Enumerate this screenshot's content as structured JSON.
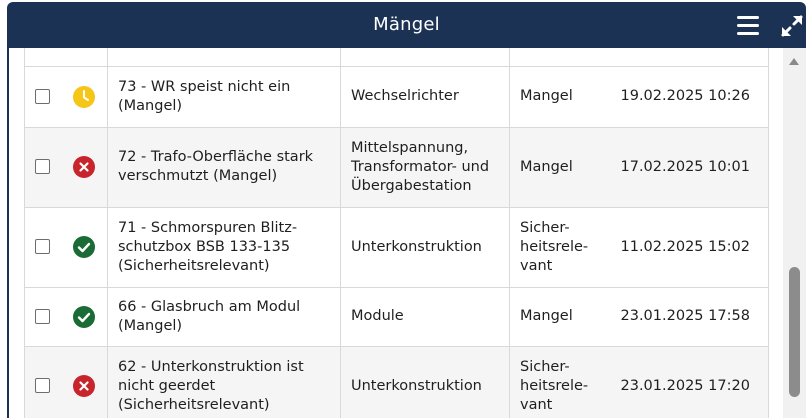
{
  "header": {
    "title": "Mängel",
    "menu_icon": "hamburger-menu-icon",
    "expand_icon": "expand-fullscreen-icon"
  },
  "rows": [
    {
      "status": "pending",
      "title": "73 - WR speist nicht ein (Mangel)",
      "category": "Wechselrichter",
      "type": "Mangel",
      "date": "19.02.2025 10:26"
    },
    {
      "status": "error",
      "title": "72 - Trafo-Oberfläche stark verschmutzt (Mangel)",
      "category": "Mittelspannung, Transformator- und Übergabestation",
      "type": "Mangel",
      "date": "17.02.2025 10:01"
    },
    {
      "status": "done",
      "title": "71 - Schmorspuren Blitz-schutzbox BSB 133-135 (Sicherheitsrelevant)",
      "category": "Unterkonstruktion",
      "type": "Sicher-heitsrele-vant",
      "date": "11.02.2025 15:02"
    },
    {
      "status": "done",
      "title": "66 - Glasbruch am Modul (Mangel)",
      "category": "Module",
      "type": "Mangel",
      "date": "23.01.2025 17:58"
    },
    {
      "status": "error",
      "title": "62 - Unterkonstruktion ist nicht geerdet (Sicherheitsrelevant)",
      "category": "Unterkonstruktion",
      "type": "Sicher-heitsrele-vant",
      "date": "23.01.2025 17:20"
    }
  ],
  "status_icons": {
    "pending": {
      "name": "clock-icon",
      "color": "#f5c518"
    },
    "error": {
      "name": "x-circle-icon",
      "color": "#c8242b"
    },
    "done": {
      "name": "check-circle-icon",
      "color": "#1a6b35"
    }
  }
}
